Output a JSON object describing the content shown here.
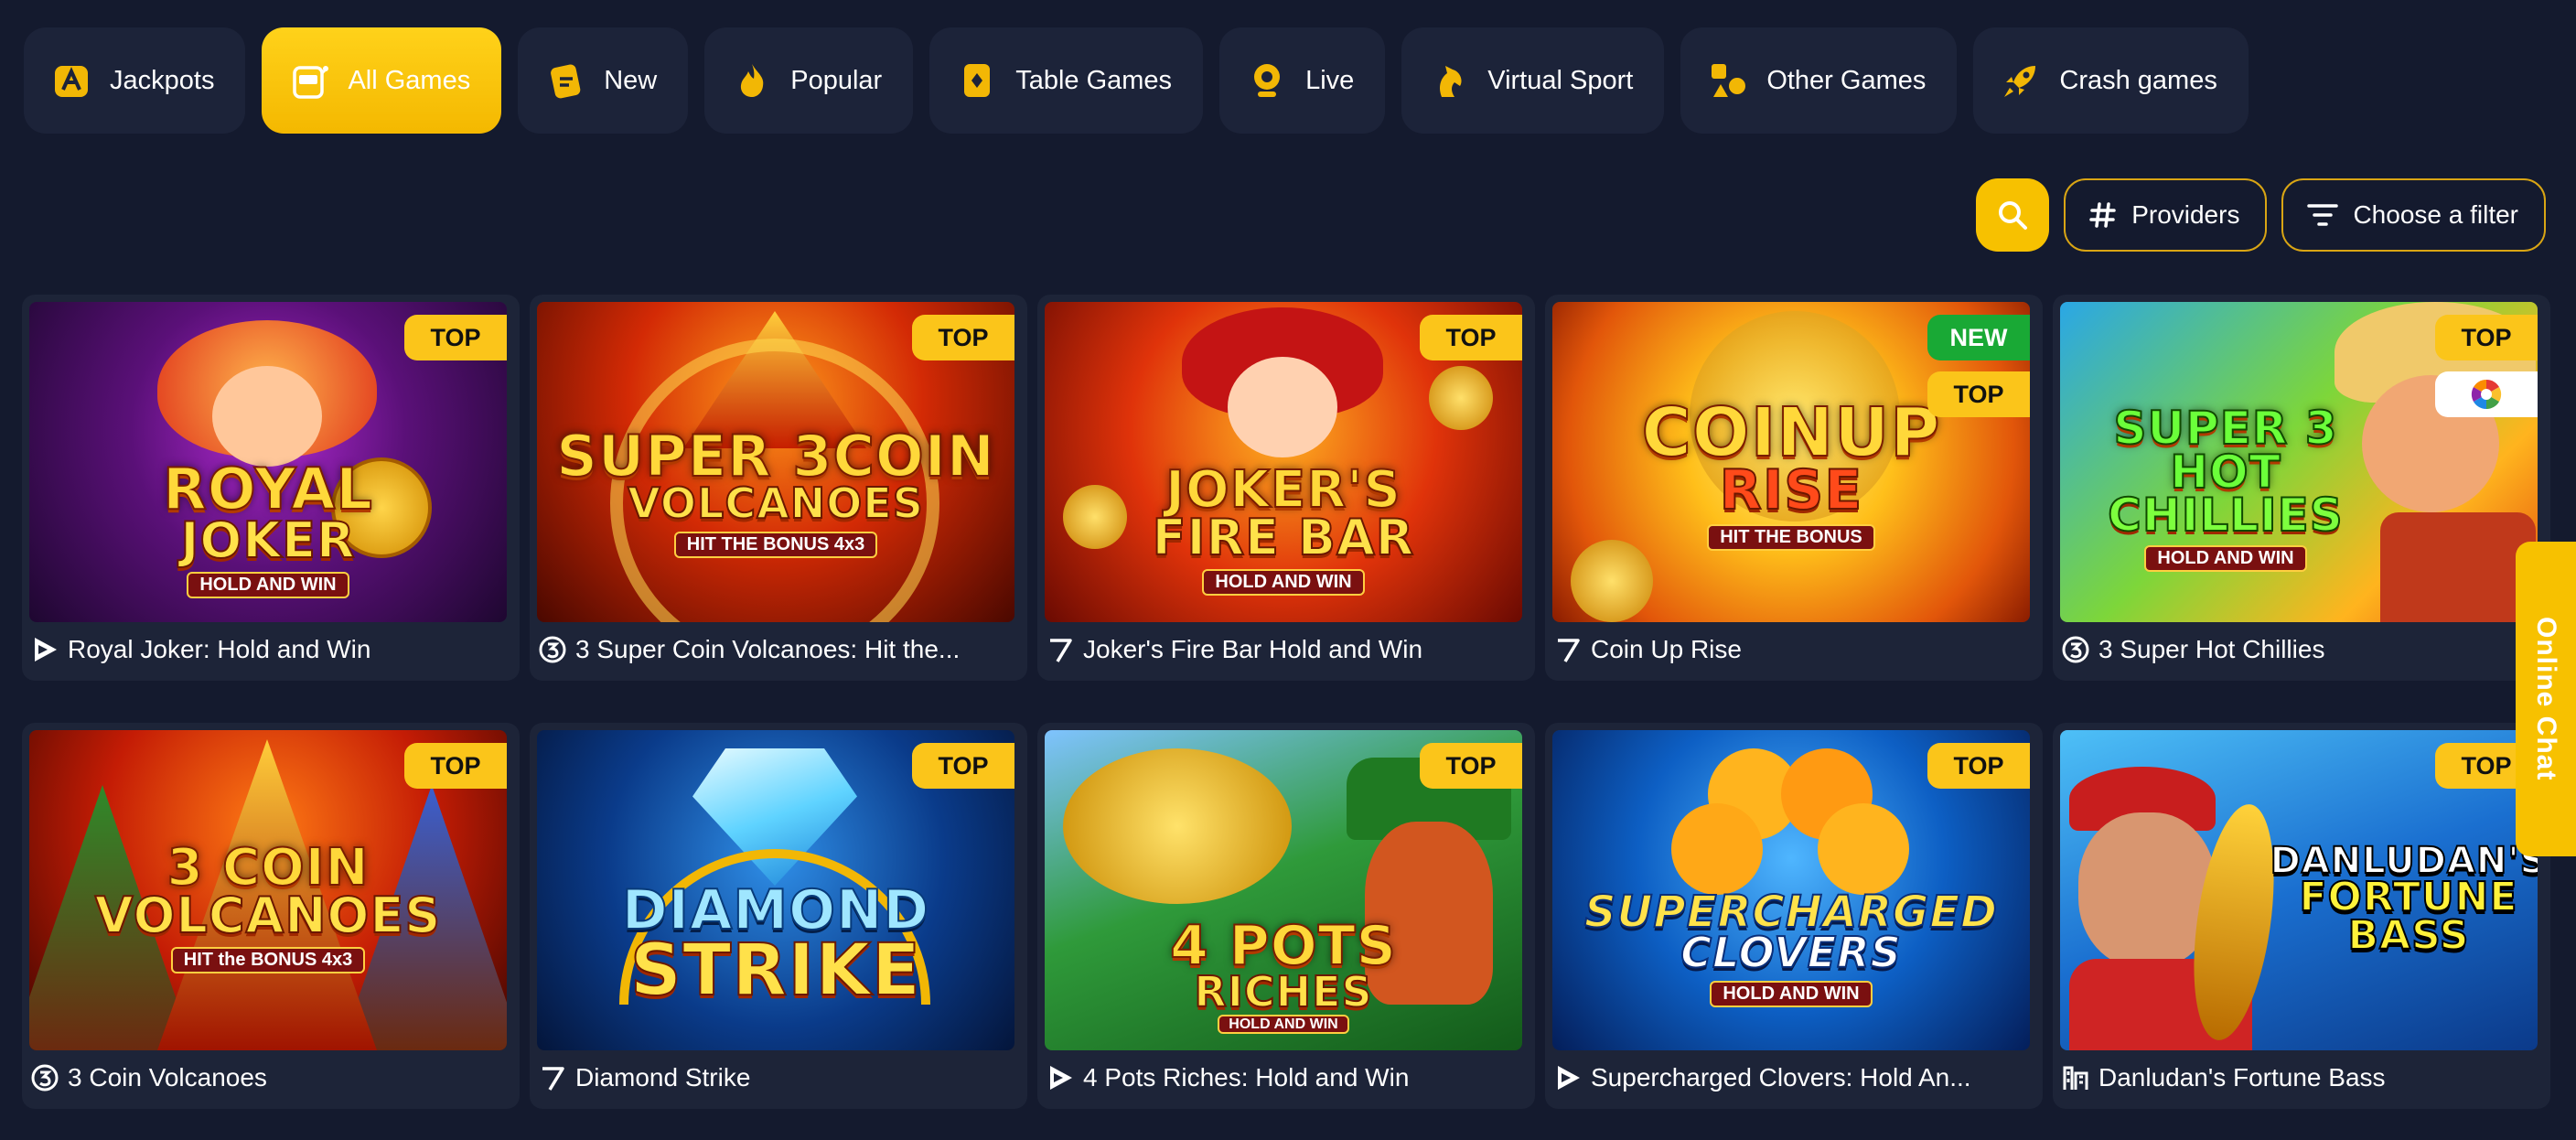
{
  "tabs": [
    {
      "label": "Jackpots",
      "icon": "jackpot-icon",
      "active": false
    },
    {
      "label": "All Games",
      "icon": "slot-machine-icon",
      "active": true
    },
    {
      "label": "New",
      "icon": "ticket-icon",
      "active": false
    },
    {
      "label": "Popular",
      "icon": "flame-icon",
      "active": false
    },
    {
      "label": "Table Games",
      "icon": "card-icon",
      "active": false
    },
    {
      "label": "Live",
      "icon": "webcam-icon",
      "active": false
    },
    {
      "label": "Virtual Sport",
      "icon": "horse-icon",
      "active": false
    },
    {
      "label": "Other Games",
      "icon": "shapes-icon",
      "active": false
    },
    {
      "label": "Crash games",
      "icon": "rocket-icon",
      "active": false
    }
  ],
  "toolbar": {
    "providers_label": "Providers",
    "filter_label": "Choose a filter",
    "search_icon": "search-icon"
  },
  "badges": {
    "top": "TOP",
    "new": "NEW"
  },
  "games": [
    {
      "title": "Royal Joker: Hold and Win",
      "art_line1": "ROYAL",
      "art_line2": "JOKER",
      "art_sub": "HOLD AND WIN",
      "badges": [
        "top"
      ],
      "provider_icon": "play-triangle-icon"
    },
    {
      "title": "3 Super Coin Volcanoes: Hit the...",
      "art_line1": "SUPER 3COIN",
      "art_line2": "VOLCANOES",
      "art_sub": "HIT THE BONUS 4x3",
      "badges": [
        "top"
      ],
      "provider_icon": "three-circle-icon"
    },
    {
      "title": "Joker's Fire Bar Hold and Win",
      "art_line1": "JOKER'S",
      "art_line2": "FIRE BAR",
      "art_sub": "HOLD AND WIN",
      "badges": [
        "top"
      ],
      "provider_icon": "seven-icon"
    },
    {
      "title": "Coin Up Rise",
      "art_line1": "COINUP",
      "art_line2": "RISE",
      "art_sub": "HIT THE BONUS",
      "badges": [
        "new",
        "top"
      ],
      "provider_icon": "seven-icon"
    },
    {
      "title": "3 Super Hot Chillies",
      "art_line1": "SUPER 3 HOT",
      "art_line2": "CHILLIES",
      "art_sub": "HOLD AND WIN",
      "badges": [
        "top"
      ],
      "provider_icon": "three-circle-icon",
      "extra_icon": "color-wheel-icon"
    },
    {
      "title": "3 Coin Volcanoes",
      "art_line1": "3 COIN",
      "art_line2": "VOLCANOES",
      "art_sub": "HIT the BONUS 4x3",
      "badges": [
        "top"
      ],
      "provider_icon": "three-circle-icon"
    },
    {
      "title": "Diamond Strike",
      "art_line1": "DIAMOND",
      "art_line2": "STRIKE",
      "art_sub": "",
      "badges": [
        "top"
      ],
      "provider_icon": "seven-icon"
    },
    {
      "title": "4 Pots Riches: Hold and Win",
      "art_line1": "4 POTS",
      "art_line2": "RICHES",
      "art_sub": "HOLD AND WIN",
      "badges": [
        "top"
      ],
      "provider_icon": "play-triangle-icon"
    },
    {
      "title": "Supercharged Clovers: Hold An...",
      "art_line1": "SUPERCHARGED",
      "art_line2": "CLOVERS",
      "art_sub": "HOLD AND WIN",
      "badges": [
        "top"
      ],
      "provider_icon": "play-triangle-icon"
    },
    {
      "title": "Danludan's Fortune Bass",
      "art_line1": "DANLUDAN'S",
      "art_line2": "FORTUNE BASS",
      "art_sub": "",
      "badges": [
        "top"
      ],
      "provider_icon": "building-icon"
    }
  ],
  "chat": {
    "label": "Online Chat"
  },
  "colors": {
    "background": "#141a2e",
    "card": "#1d2438",
    "accent": "#f7c100",
    "new_badge": "#19a935"
  }
}
